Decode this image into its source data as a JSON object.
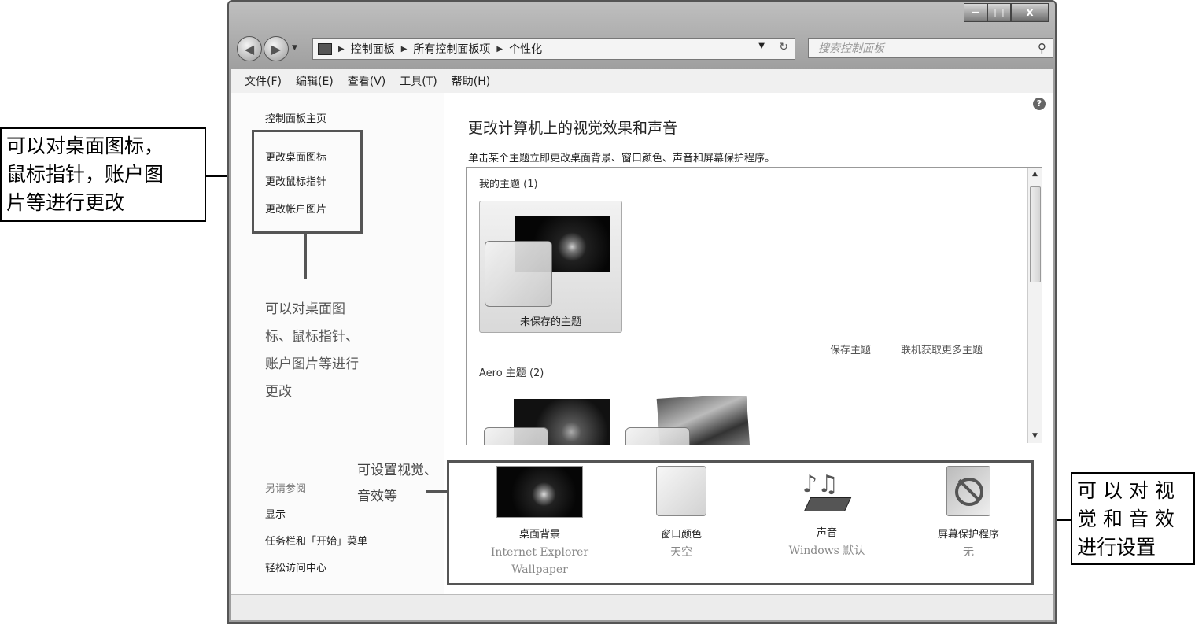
{
  "window": {
    "controls": {
      "minimize": "−",
      "maximize": "□",
      "close": "x"
    },
    "address": {
      "crumbs": [
        "控制面板",
        "所有控制面板项",
        "个性化"
      ]
    },
    "search_placeholder": "搜索控制面板",
    "menu": [
      "文件(F)",
      "编辑(E)",
      "查看(V)",
      "工具(T)",
      "帮助(H)"
    ]
  },
  "left_pane": {
    "home": "控制面板主页",
    "links": [
      "更改桌面图标",
      "更改鼠标指针",
      "更改帐户图片"
    ],
    "annotation": [
      "可以对桌面图",
      "标、鼠标指针、",
      "账户图片等进行",
      "更改"
    ],
    "see_also_title": "另请参阅",
    "see_also": [
      "显示",
      "任务栏和「开始」菜单",
      "轻松访问中心"
    ]
  },
  "main": {
    "title": "更改计算机上的视觉效果和声音",
    "subtitle": "单击某个主题立即更改桌面背景、窗口颜色、声音和屏幕保护程序。",
    "group_my": "我的主题 (1)",
    "unsaved_theme": "未保存的主题",
    "save_theme": "保存主题",
    "more_online": "联机获取更多主题",
    "group_aero": "Aero 主题 (2)",
    "mid_annotation": [
      "可设置视觉、",
      "音效等"
    ]
  },
  "bottom": [
    {
      "label": "桌面背景",
      "value": [
        "Internet Explorer",
        "Wallpaper"
      ],
      "icon": "desktop-background-icon"
    },
    {
      "label": "窗口颜色",
      "value": [
        "天空"
      ],
      "icon": "window-color-icon"
    },
    {
      "label": "声音",
      "value": [
        "Windows 默认"
      ],
      "icon": "sound-icon"
    },
    {
      "label": "屏幕保护程序",
      "value": [
        "无"
      ],
      "icon": "screensaver-icon"
    }
  ],
  "callouts": {
    "left": [
      "可以对桌面图标，",
      "鼠标指针，账户图",
      "片等进行更改"
    ],
    "right": [
      "可 以 对 视",
      "觉 和 音 效",
      "进行设置"
    ]
  }
}
